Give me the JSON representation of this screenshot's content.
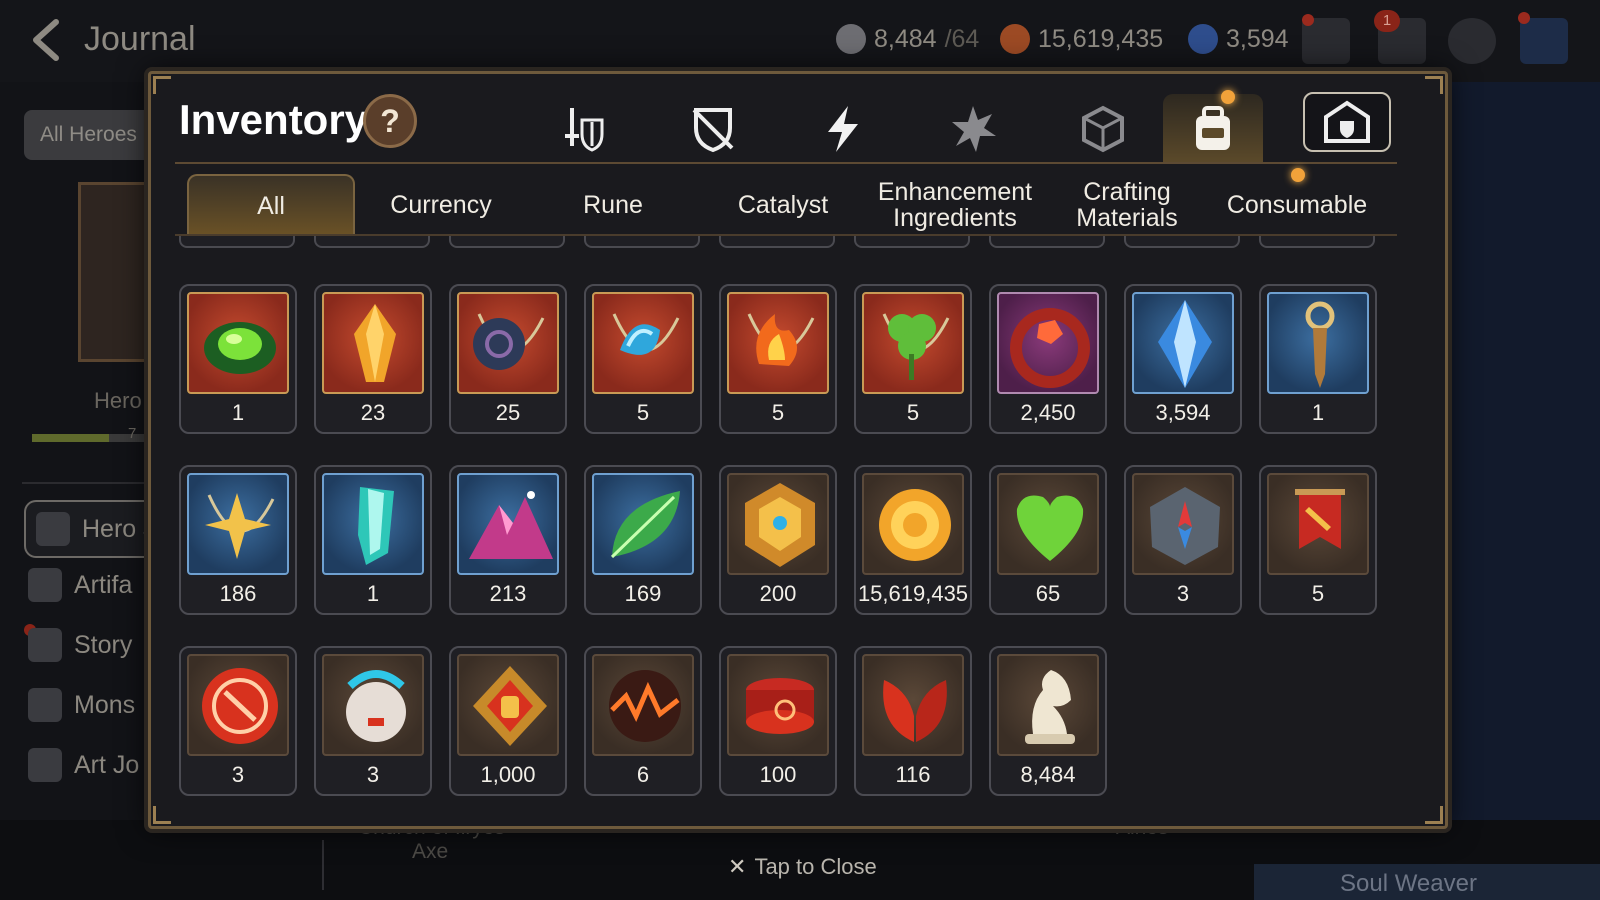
{
  "journal": {
    "title": "Journal",
    "resources": [
      {
        "name": "stamina-icon",
        "value": "8,484",
        "sub": "/64",
        "color": "#7a7a80"
      },
      {
        "name": "gold-icon",
        "value": "15,619,435",
        "sub": "",
        "color": "#b55a2a"
      },
      {
        "name": "skystone-icon",
        "value": "3,594",
        "sub": "",
        "color": "#3a5ea8"
      }
    ],
    "mail_badge": "1",
    "all_heroes": "All Heroes",
    "hero_label": "Hero",
    "hero_progress_text": "7",
    "hero_progress": 0.6,
    "menu": [
      {
        "label": "Hero J",
        "icon": "hero-icon"
      },
      {
        "label": "Artifa",
        "icon": "artifact-icon"
      },
      {
        "label": "Story",
        "icon": "story-icon"
      },
      {
        "label": "Mons",
        "icon": "monster-icon"
      },
      {
        "label": "Art Jo",
        "icon": "art-icon"
      }
    ],
    "bottom_left_label_1": "Church of Ilryos",
    "bottom_left_label_2": "Axe",
    "bottom_right_label": "Ainos",
    "soul_weaver": "Soul Weaver"
  },
  "inventory": {
    "title": "Inventory",
    "help": "?",
    "tap_to_close": "Tap to Close",
    "categories": [
      {
        "name": "weapon-armor-tab-icon",
        "active": false
      },
      {
        "name": "broken-gear-tab-icon",
        "active": false
      },
      {
        "name": "artifact-lightning-tab-icon",
        "active": false
      },
      {
        "name": "skill-material-tab-icon",
        "active": false
      },
      {
        "name": "cube-tab-icon",
        "active": false
      },
      {
        "name": "backpack-tab-icon",
        "active": true
      },
      {
        "name": "storage-tab-icon",
        "active": false
      }
    ],
    "subtabs": [
      {
        "label": "All",
        "active": true
      },
      {
        "label": "Currency",
        "active": false
      },
      {
        "label": "Rune",
        "active": false
      },
      {
        "label": "Catalyst",
        "active": false
      },
      {
        "label": "Enhancement Ingredients",
        "active": false
      },
      {
        "label": "Crafting Materials",
        "active": false
      },
      {
        "label": "Consumable",
        "active": false
      }
    ],
    "items": [
      {
        "count": "1",
        "icon": "green-ring-icon",
        "bg": "red"
      },
      {
        "count": "23",
        "icon": "amber-crystal-icon",
        "bg": "red"
      },
      {
        "count": "25",
        "icon": "dark-disc-necklace-icon",
        "bg": "red"
      },
      {
        "count": "5",
        "icon": "water-drop-necklace-icon",
        "bg": "red"
      },
      {
        "count": "5",
        "icon": "fire-necklace-icon",
        "bg": "red"
      },
      {
        "count": "5",
        "icon": "clover-necklace-icon",
        "bg": "red"
      },
      {
        "count": "2,450",
        "icon": "red-crescent-ring-icon",
        "bg": "purple"
      },
      {
        "count": "3,594",
        "icon": "skystone-crystal-icon",
        "bg": "blue"
      },
      {
        "count": "1",
        "icon": "golden-key-icon",
        "bg": "blue"
      },
      {
        "count": "186",
        "icon": "star-necklace-icon",
        "bg": "blue"
      },
      {
        "count": "1",
        "icon": "teal-crystal-icon",
        "bg": "blue"
      },
      {
        "count": "213",
        "icon": "pink-mountain-icon",
        "bg": "blue"
      },
      {
        "count": "169",
        "icon": "green-leaf-icon",
        "bg": "blue"
      },
      {
        "count": "200",
        "icon": "gold-emblem-icon",
        "bg": "brown"
      },
      {
        "count": "15,619,435",
        "icon": "gold-coin-icon",
        "bg": "brown"
      },
      {
        "count": "65",
        "icon": "green-heart-icon",
        "bg": "brown"
      },
      {
        "count": "3",
        "icon": "stone-compass-icon",
        "bg": "brown"
      },
      {
        "count": "5",
        "icon": "red-banner-icon",
        "bg": "brown"
      },
      {
        "count": "3",
        "icon": "red-seal-icon",
        "bg": "brown"
      },
      {
        "count": "3",
        "icon": "mech-orb-icon",
        "bg": "brown"
      },
      {
        "count": "1,000",
        "icon": "fist-crest-icon",
        "bg": "brown"
      },
      {
        "count": "6",
        "icon": "lava-orb-icon",
        "bg": "brown"
      },
      {
        "count": "100",
        "icon": "red-band-icon",
        "bg": "brown"
      },
      {
        "count": "116",
        "icon": "red-wings-icon",
        "bg": "brown"
      },
      {
        "count": "8,484",
        "icon": "knight-piece-icon",
        "bg": "brown"
      }
    ]
  }
}
